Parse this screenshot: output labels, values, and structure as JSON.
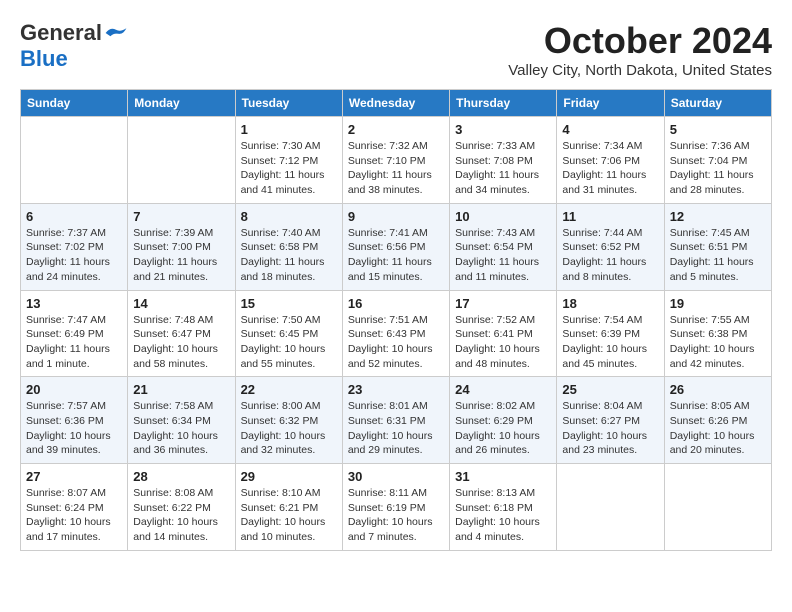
{
  "logo": {
    "general": "General",
    "blue": "Blue"
  },
  "title": "October 2024",
  "location": "Valley City, North Dakota, United States",
  "days_of_week": [
    "Sunday",
    "Monday",
    "Tuesday",
    "Wednesday",
    "Thursday",
    "Friday",
    "Saturday"
  ],
  "weeks": [
    [
      {
        "day": "",
        "info": ""
      },
      {
        "day": "",
        "info": ""
      },
      {
        "day": "1",
        "info": "Sunrise: 7:30 AM\nSunset: 7:12 PM\nDaylight: 11 hours and 41 minutes."
      },
      {
        "day": "2",
        "info": "Sunrise: 7:32 AM\nSunset: 7:10 PM\nDaylight: 11 hours and 38 minutes."
      },
      {
        "day": "3",
        "info": "Sunrise: 7:33 AM\nSunset: 7:08 PM\nDaylight: 11 hours and 34 minutes."
      },
      {
        "day": "4",
        "info": "Sunrise: 7:34 AM\nSunset: 7:06 PM\nDaylight: 11 hours and 31 minutes."
      },
      {
        "day": "5",
        "info": "Sunrise: 7:36 AM\nSunset: 7:04 PM\nDaylight: 11 hours and 28 minutes."
      }
    ],
    [
      {
        "day": "6",
        "info": "Sunrise: 7:37 AM\nSunset: 7:02 PM\nDaylight: 11 hours and 24 minutes."
      },
      {
        "day": "7",
        "info": "Sunrise: 7:39 AM\nSunset: 7:00 PM\nDaylight: 11 hours and 21 minutes."
      },
      {
        "day": "8",
        "info": "Sunrise: 7:40 AM\nSunset: 6:58 PM\nDaylight: 11 hours and 18 minutes."
      },
      {
        "day": "9",
        "info": "Sunrise: 7:41 AM\nSunset: 6:56 PM\nDaylight: 11 hours and 15 minutes."
      },
      {
        "day": "10",
        "info": "Sunrise: 7:43 AM\nSunset: 6:54 PM\nDaylight: 11 hours and 11 minutes."
      },
      {
        "day": "11",
        "info": "Sunrise: 7:44 AM\nSunset: 6:52 PM\nDaylight: 11 hours and 8 minutes."
      },
      {
        "day": "12",
        "info": "Sunrise: 7:45 AM\nSunset: 6:51 PM\nDaylight: 11 hours and 5 minutes."
      }
    ],
    [
      {
        "day": "13",
        "info": "Sunrise: 7:47 AM\nSunset: 6:49 PM\nDaylight: 11 hours and 1 minute."
      },
      {
        "day": "14",
        "info": "Sunrise: 7:48 AM\nSunset: 6:47 PM\nDaylight: 10 hours and 58 minutes."
      },
      {
        "day": "15",
        "info": "Sunrise: 7:50 AM\nSunset: 6:45 PM\nDaylight: 10 hours and 55 minutes."
      },
      {
        "day": "16",
        "info": "Sunrise: 7:51 AM\nSunset: 6:43 PM\nDaylight: 10 hours and 52 minutes."
      },
      {
        "day": "17",
        "info": "Sunrise: 7:52 AM\nSunset: 6:41 PM\nDaylight: 10 hours and 48 minutes."
      },
      {
        "day": "18",
        "info": "Sunrise: 7:54 AM\nSunset: 6:39 PM\nDaylight: 10 hours and 45 minutes."
      },
      {
        "day": "19",
        "info": "Sunrise: 7:55 AM\nSunset: 6:38 PM\nDaylight: 10 hours and 42 minutes."
      }
    ],
    [
      {
        "day": "20",
        "info": "Sunrise: 7:57 AM\nSunset: 6:36 PM\nDaylight: 10 hours and 39 minutes."
      },
      {
        "day": "21",
        "info": "Sunrise: 7:58 AM\nSunset: 6:34 PM\nDaylight: 10 hours and 36 minutes."
      },
      {
        "day": "22",
        "info": "Sunrise: 8:00 AM\nSunset: 6:32 PM\nDaylight: 10 hours and 32 minutes."
      },
      {
        "day": "23",
        "info": "Sunrise: 8:01 AM\nSunset: 6:31 PM\nDaylight: 10 hours and 29 minutes."
      },
      {
        "day": "24",
        "info": "Sunrise: 8:02 AM\nSunset: 6:29 PM\nDaylight: 10 hours and 26 minutes."
      },
      {
        "day": "25",
        "info": "Sunrise: 8:04 AM\nSunset: 6:27 PM\nDaylight: 10 hours and 23 minutes."
      },
      {
        "day": "26",
        "info": "Sunrise: 8:05 AM\nSunset: 6:26 PM\nDaylight: 10 hours and 20 minutes."
      }
    ],
    [
      {
        "day": "27",
        "info": "Sunrise: 8:07 AM\nSunset: 6:24 PM\nDaylight: 10 hours and 17 minutes."
      },
      {
        "day": "28",
        "info": "Sunrise: 8:08 AM\nSunset: 6:22 PM\nDaylight: 10 hours and 14 minutes."
      },
      {
        "day": "29",
        "info": "Sunrise: 8:10 AM\nSunset: 6:21 PM\nDaylight: 10 hours and 10 minutes."
      },
      {
        "day": "30",
        "info": "Sunrise: 8:11 AM\nSunset: 6:19 PM\nDaylight: 10 hours and 7 minutes."
      },
      {
        "day": "31",
        "info": "Sunrise: 8:13 AM\nSunset: 6:18 PM\nDaylight: 10 hours and 4 minutes."
      },
      {
        "day": "",
        "info": ""
      },
      {
        "day": "",
        "info": ""
      }
    ]
  ]
}
